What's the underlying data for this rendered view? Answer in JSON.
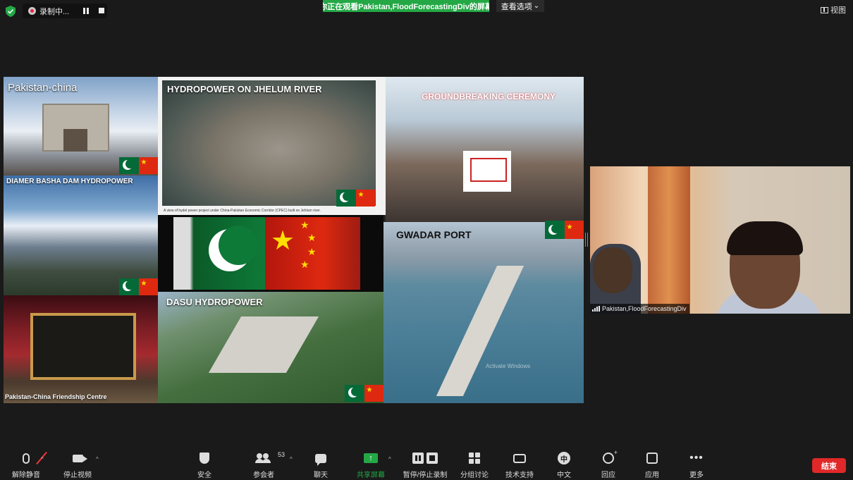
{
  "top_bar": {
    "recording_label": "录制中...",
    "viewing_banner": "你正在观看Pakistan,FloodForecastingDiv的屏幕",
    "view_options": "查看选项",
    "view_options_arrow": "⌄",
    "view_button": "视图"
  },
  "shared_content": {
    "captions": {
      "pakistan_china": "Pakistan-china",
      "hydropower_jhelum": "HYDROPOWER ON JHELUM RIVER",
      "jhelum_note": "A view of hydel power project under China-Pakistan Economic Corridor (CPEC) built on Jehlum river.",
      "groundbreaking": "GROUNDBREAKING CEREMONY",
      "diamer_basha": "DIAMER BASHA DAM HYDROPOWER",
      "gwadar_port": "GWADAR PORT",
      "friendship_centre": "Pakistan-China Friendship Centre",
      "dasu_hydropower": "DASU HYDROPOWER",
      "watermark": "Activate Windows"
    }
  },
  "participant": {
    "name": "Pakistan,FloodForecastingDiv"
  },
  "toolbar": {
    "unmute": "解除静音",
    "stop_video": "停止视频",
    "security": "安全",
    "participants": "参会者",
    "participants_count": "53",
    "chat": "聊天",
    "share_screen": "共享屏幕",
    "share_icon": "↑",
    "pause_stop_recording": "暂停/停止录制",
    "breakout_rooms": "分组讨论",
    "tech_support": "技术支持",
    "language": "中文",
    "language_icon": "中",
    "reactions": "回应",
    "apps": "应用",
    "more": "更多",
    "more_icon": "•••",
    "caret": "^",
    "end": "结束"
  },
  "colors": {
    "share_green": "#23a845",
    "end_red": "#e02828",
    "background": "#1a1a1a"
  }
}
